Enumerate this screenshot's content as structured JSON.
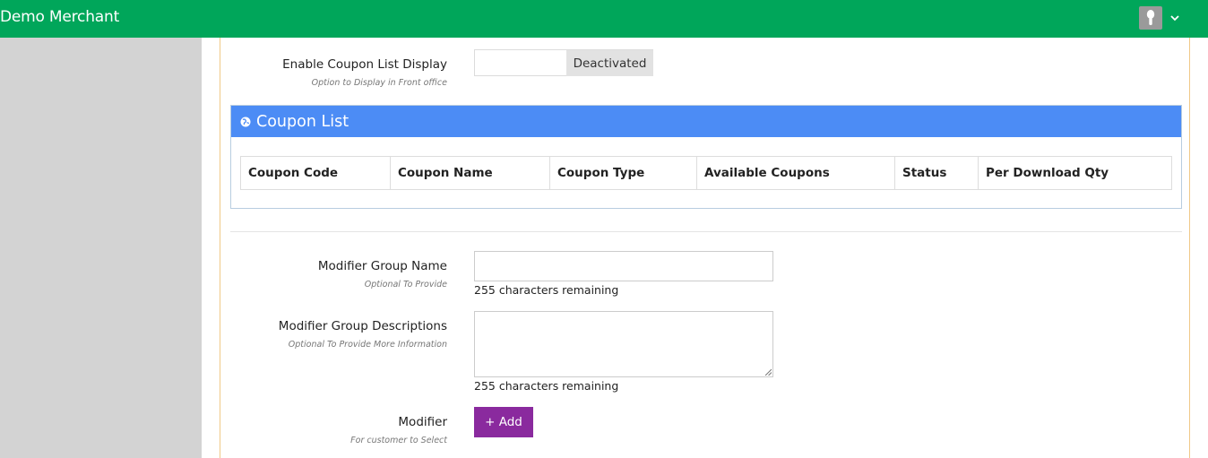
{
  "topbar": {
    "brand": "Demo Merchant",
    "accent_color": "#00a65a",
    "avatar_icon": "user-silhouette-icon",
    "menu_icon": "chevron-down-icon"
  },
  "coupon_display": {
    "label": "Enable Coupon List Display",
    "hint": "Option to Display in Front office",
    "toggle_state": "Deactivated"
  },
  "coupon_list": {
    "title": "Coupon List",
    "header_color": "#4c8cf5",
    "columns": [
      "Coupon Code",
      "Coupon Name",
      "Coupon Type",
      "Available Coupons",
      "Status",
      "Per Download Qty"
    ]
  },
  "modifier_group_name": {
    "label": "Modifier Group Name",
    "hint": "Optional To Provide",
    "value": "",
    "counter": "255 characters remaining"
  },
  "modifier_group_descriptions": {
    "label": "Modifier Group Descriptions",
    "hint": "Optional To Provide More Information",
    "value": "",
    "counter": "255 characters remaining"
  },
  "modifier": {
    "label": "Modifier",
    "hint": "For customer to Select",
    "add_label": "+ Add",
    "button_color": "#8a2a9e"
  }
}
